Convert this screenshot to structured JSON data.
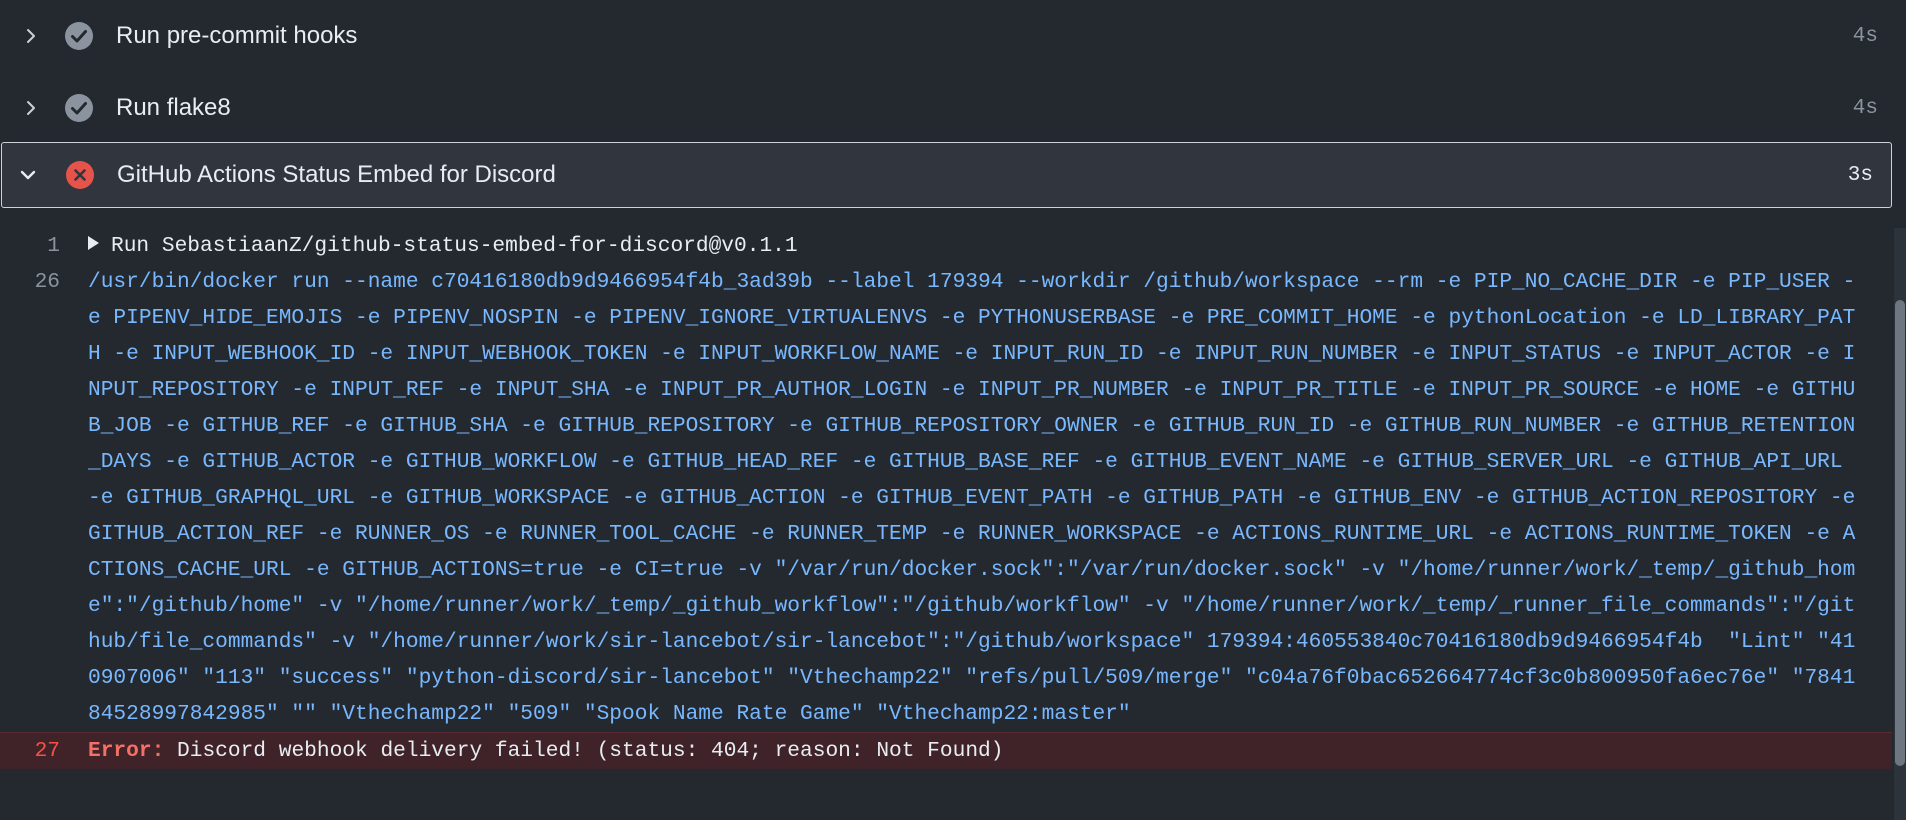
{
  "steps": [
    {
      "name": "Run pre-commit hooks",
      "duration": "4s",
      "status": "success",
      "expanded": false
    },
    {
      "name": "Run flake8",
      "duration": "4s",
      "status": "success",
      "expanded": false
    },
    {
      "name": "GitHub Actions Status Embed for Discord",
      "duration": "3s",
      "status": "failure",
      "expanded": true
    }
  ],
  "log": {
    "group": {
      "line": "1",
      "text": "Run SebastiaanZ/github-status-embed-for-discord@v0.1.1"
    },
    "command": {
      "line": "26",
      "text": "/usr/bin/docker run --name c70416180db9d9466954f4b_3ad39b --label 179394 --workdir /github/workspace --rm -e PIP_NO_CACHE_DIR -e PIP_USER -e PIPENV_HIDE_EMOJIS -e PIPENV_NOSPIN -e PIPENV_IGNORE_VIRTUALENVS -e PYTHONUSERBASE -e PRE_COMMIT_HOME -e pythonLocation -e LD_LIBRARY_PATH -e INPUT_WEBHOOK_ID -e INPUT_WEBHOOK_TOKEN -e INPUT_WORKFLOW_NAME -e INPUT_RUN_ID -e INPUT_RUN_NUMBER -e INPUT_STATUS -e INPUT_ACTOR -e INPUT_REPOSITORY -e INPUT_REF -e INPUT_SHA -e INPUT_PR_AUTHOR_LOGIN -e INPUT_PR_NUMBER -e INPUT_PR_TITLE -e INPUT_PR_SOURCE -e HOME -e GITHUB_JOB -e GITHUB_REF -e GITHUB_SHA -e GITHUB_REPOSITORY -e GITHUB_REPOSITORY_OWNER -e GITHUB_RUN_ID -e GITHUB_RUN_NUMBER -e GITHUB_RETENTION_DAYS -e GITHUB_ACTOR -e GITHUB_WORKFLOW -e GITHUB_HEAD_REF -e GITHUB_BASE_REF -e GITHUB_EVENT_NAME -e GITHUB_SERVER_URL -e GITHUB_API_URL -e GITHUB_GRAPHQL_URL -e GITHUB_WORKSPACE -e GITHUB_ACTION -e GITHUB_EVENT_PATH -e GITHUB_PATH -e GITHUB_ENV -e GITHUB_ACTION_REPOSITORY -e GITHUB_ACTION_REF -e RUNNER_OS -e RUNNER_TOOL_CACHE -e RUNNER_TEMP -e RUNNER_WORKSPACE -e ACTIONS_RUNTIME_URL -e ACTIONS_RUNTIME_TOKEN -e ACTIONS_CACHE_URL -e GITHUB_ACTIONS=true -e CI=true -v \"/var/run/docker.sock\":\"/var/run/docker.sock\" -v \"/home/runner/work/_temp/_github_home\":\"/github/home\" -v \"/home/runner/work/_temp/_github_workflow\":\"/github/workflow\" -v \"/home/runner/work/_temp/_runner_file_commands\":\"/github/file_commands\" -v \"/home/runner/work/sir-lancebot/sir-lancebot\":\"/github/workspace\" 179394:460553840c70416180db9d9466954f4b  \"Lint\" \"410907006\" \"113\" \"success\" \"python-discord/sir-lancebot\" \"Vthechamp22\" \"refs/pull/509/merge\" \"c04a76f0bac652664774cf3c0b800950fa6ec76e\" \"784184528997842985\" \"\" \"Vthechamp22\" \"509\" \"Spook Name Rate Game\" \"Vthechamp22:master\""
    },
    "error": {
      "line": "27",
      "label": "Error:",
      "text": " Discord webhook delivery failed! (status: 404; reason: Not Found)"
    }
  },
  "icons": {
    "collapsed": "chevron-right-icon",
    "expanded": "chevron-down-icon",
    "success": "check-circle-icon",
    "failure": "x-circle-icon"
  },
  "colors": {
    "background": "#24292f",
    "success_icon": "#8b949e",
    "failure_icon": "#e5534b",
    "command_text": "#79b8ff",
    "error_label": "#f47067",
    "error_row_bg": "#3f2328"
  }
}
